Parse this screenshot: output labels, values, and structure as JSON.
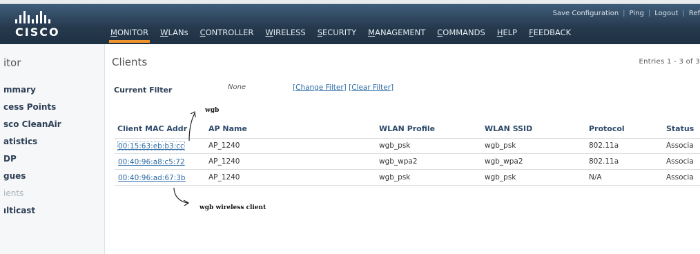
{
  "header": {
    "logo_text": "CISCO",
    "utility_links": [
      "Save Configuration",
      "Ping",
      "Logout",
      "Ref"
    ],
    "nav_items": [
      "MONITOR",
      "WLANs",
      "CONTROLLER",
      "WIRELESS",
      "SECURITY",
      "MANAGEMENT",
      "COMMANDS",
      "HELP",
      "FEEDBACK"
    ],
    "active_nav": "MONITOR",
    "accent_color": "#f0932b"
  },
  "sidebar": {
    "title": "itor",
    "items": [
      "mmary",
      "cess Points",
      "sco CleanAir",
      "atistics",
      "DP",
      "gues",
      "ients",
      "ılticast"
    ],
    "current_item": "ients"
  },
  "main": {
    "title": "Clients",
    "entries": "Entries 1 - 3 of 3",
    "filter": {
      "label": "Current Filter",
      "value": "None",
      "change_link": "Change Filter",
      "clear_link": "Clear Filter"
    },
    "table": {
      "columns": [
        "Client MAC Addr",
        "AP Name",
        "WLAN Profile",
        "WLAN SSID",
        "Protocol",
        "Status"
      ],
      "rows": [
        [
          "00:15:63:eb:b3:cc",
          "AP_1240",
          "wgb_psk",
          "wgb_psk",
          "802.11a",
          "Associa"
        ],
        [
          "00:40:96:a8:c5:72",
          "AP_1240",
          "wgb_wpa2",
          "wgb_wpa2",
          "802.11a",
          "Associa"
        ],
        [
          "00:40:96:ad:67:3b",
          "AP_1240",
          "wgb_psk",
          "wgb_psk",
          "N/A",
          "Associa"
        ]
      ]
    }
  },
  "annotations": {
    "top": "wgb",
    "bottom": "wgb wireless client"
  }
}
